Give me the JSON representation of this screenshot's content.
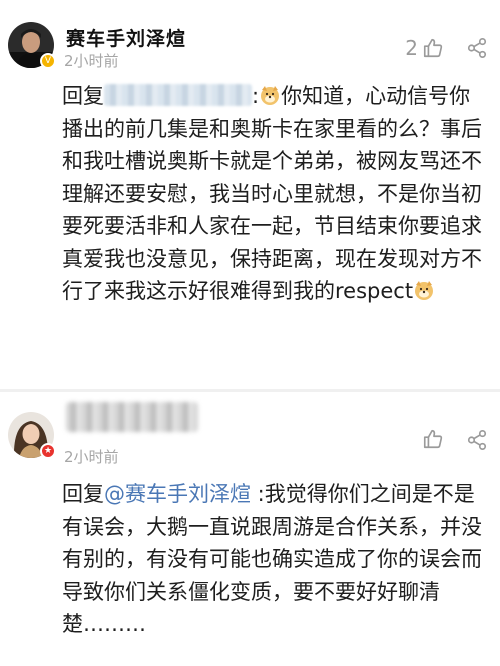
{
  "comments": [
    {
      "username": "赛车手刘泽煊",
      "time": "2小时前",
      "like_count": "2",
      "reply_prefix": "回复",
      "text_part1": "你知道，心动信号你播出的前几集是和奥斯卡在家里看的么？事后和我吐槽说奥斯卡就是个弟弟，被网友骂还不理解还要安慰，我当时心里就想，不是你当初要死要活非和人家在一起，节目结束你要追求真爱我也没意见，保持距离，现在发现对方不行了来我这示好很难得到我的respect",
      "badge": "V"
    },
    {
      "username": "",
      "time": "2小时前",
      "like_count": "",
      "reply_prefix": "回复",
      "mention": "@赛车手刘泽煊",
      "text": " :我觉得你们之间是不是有误会，大鹅一直说跟周游是合作关系，并没有别的，有没有可能也确实造成了你的误会而导致你们关系僵化变质，要不要好好聊清楚………",
      "badge": "★"
    }
  ],
  "colors": {
    "mention": "#4a77b5",
    "time": "#a6a6a6",
    "icon": "#9a9a9a"
  }
}
